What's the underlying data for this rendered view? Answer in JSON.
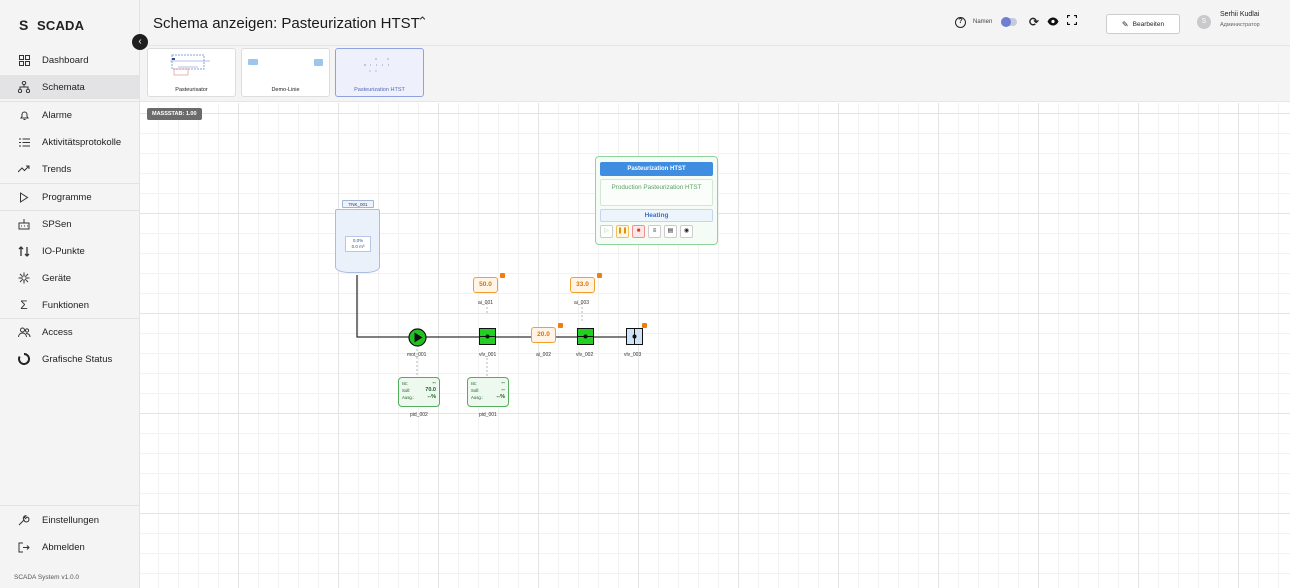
{
  "app": {
    "brand": "SCADA",
    "brand_logo": "S",
    "version": "SCADA System v1.0.0"
  },
  "sidebar": {
    "items": [
      {
        "label": "Dashboard",
        "icon": "dashboard-icon"
      },
      {
        "label": "Schemata",
        "icon": "schema-icon",
        "active": true
      },
      {
        "label": "Alarme",
        "icon": "bell-icon"
      },
      {
        "label": "Aktivitätsprotokolle",
        "icon": "list-icon"
      },
      {
        "label": "Trends",
        "icon": "trend-icon"
      },
      {
        "label": "Programme",
        "icon": "play-outline-icon"
      },
      {
        "label": "SPSen",
        "icon": "plc-icon"
      },
      {
        "label": "IO-Punkte",
        "icon": "io-icon"
      },
      {
        "label": "Geräte",
        "icon": "device-icon"
      },
      {
        "label": "Funktionen",
        "icon": "sigma-icon"
      },
      {
        "label": "Access",
        "icon": "users-icon"
      },
      {
        "label": "Grafische Status",
        "icon": "status-ring-icon"
      }
    ],
    "bottom": [
      {
        "label": "Einstellungen",
        "icon": "wrench-icon"
      },
      {
        "label": "Abmelden",
        "icon": "logout-icon"
      }
    ]
  },
  "header": {
    "title": "Schema anzeigen: Pasteurization HTST",
    "names_label": "Namen",
    "edit_label": "Bearbeiten",
    "user": {
      "initial": "S",
      "name": "Serhii Kudlai",
      "role": "Администратор"
    }
  },
  "thumbnails": [
    {
      "label": "Pasteurisator",
      "active": false
    },
    {
      "label": "Demo-Linie",
      "active": false
    },
    {
      "label": "Pasteurization HTST",
      "active": true
    }
  ],
  "canvas": {
    "scale_badge": "MASSSTAB: 1.00",
    "tank": {
      "tag": "TNK_001",
      "level": "0.0%",
      "volume": "0.0 m³"
    },
    "pump": {
      "label": "mot_001"
    },
    "valves": [
      {
        "label": "vlv_001"
      },
      {
        "label": "vlv_002"
      },
      {
        "label": "vlv_003"
      }
    ],
    "analog_inputs": [
      {
        "label": "ai_001",
        "value": "50.0"
      },
      {
        "label": "ai_002",
        "value": "20.0"
      },
      {
        "label": "ai_003",
        "value": "33.0"
      }
    ],
    "pids": [
      {
        "label": "pid_002",
        "ist": "--",
        "soll": "70.0",
        "ausg": "--%",
        "ist_label": "Ist:",
        "soll_label": "Soll:",
        "ausg_label": "Ausg.:"
      },
      {
        "label": "pid_001",
        "ist": "--",
        "soll": "--",
        "ausg": "--%",
        "ist_label": "Ist:",
        "soll_label": "Soll:",
        "ausg_label": "Ausg.:"
      }
    ],
    "program": {
      "title": "Pasteurization HTST",
      "description": "Production Pasteurization HTST",
      "state": "Heating"
    }
  },
  "colors": {
    "pump": "#22c022",
    "valve": "#22d022",
    "ai_border": "#f0a030",
    "program_title": "#3f8de0"
  }
}
